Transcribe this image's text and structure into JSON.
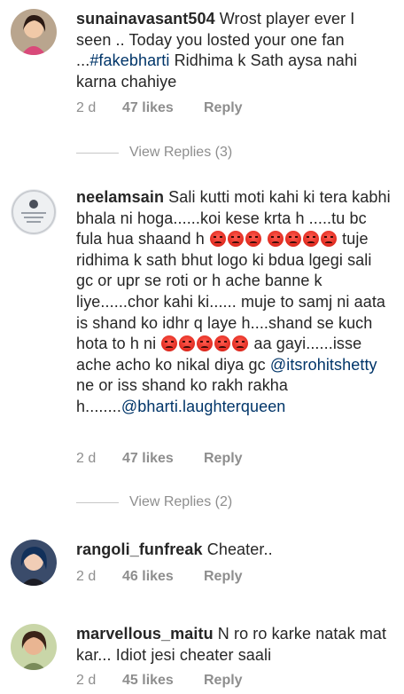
{
  "comments": [
    {
      "username": "sunainavasant504",
      "text_a": " Wrost player ever I seen .. Today you losted your one fan ...",
      "hashtag": "#fakebharti",
      "text_b": " Ridhima k Sath aysa nahi karna chahiye",
      "time": "2 d",
      "likes": "47 likes",
      "reply": "Reply",
      "view_replies": "View Replies (3)"
    },
    {
      "username": "neelamsain",
      "text_a": " Sali kutti moti kahi ki tera kabhi bhala ni hoga......koi kese krta h .....tu bc fula hua shaand h ",
      "text_b": " tuje ridhima k sath bhut logo ki bdua lgegi sali gc or upr se roti or h ache banne k liye......chor kahi ki...... muje to samj ni aata is shand ko idhr q laye h....shand se kuch hota to h ni ",
      "text_c": " aa gayi......isse ache acho ko nikal diya gc ",
      "mention1": "@itsrohitshetty",
      "text_d": " ne or iss shand ko rakh rakha h........",
      "mention2": "@bharti.laughterqueen",
      "time": "2 d",
      "likes": "47 likes",
      "reply": "Reply",
      "view_replies": "View Replies (2)"
    },
    {
      "username": "rangoli_funfreak",
      "text_a": " Cheater..",
      "time": "2 d",
      "likes": "46 likes",
      "reply": "Reply"
    },
    {
      "username": "marvellous_maitu",
      "text_a": " N ro ro karke natak mat kar... Idiot jesi cheater saali",
      "time": "2 d",
      "likes": "45 likes",
      "reply": "Reply"
    }
  ],
  "icons": {
    "emoji": "pouting-face-emoji"
  },
  "colors": {
    "text": "#262626",
    "meta": "#8e8e8e",
    "link": "#003569"
  }
}
